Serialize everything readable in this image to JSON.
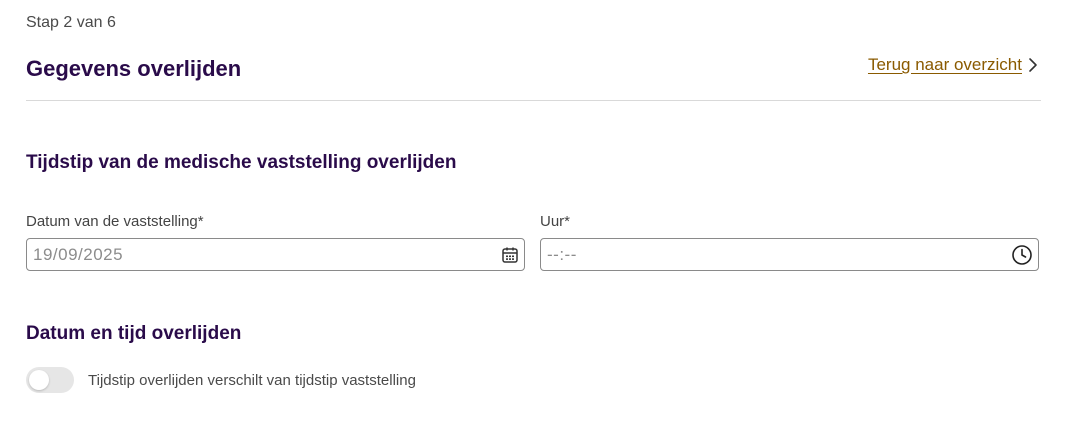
{
  "header": {
    "step": "Stap 2 van 6",
    "title": "Gegevens overlijden",
    "back_link": "Terug naar overzicht"
  },
  "sections": {
    "vaststelling": {
      "title": "Tijdstip van de medische vaststelling overlijden",
      "date_label": "Datum van de vaststelling*",
      "date_value": "19/09/2025",
      "time_label": "Uur*",
      "time_value": "--:--"
    },
    "overlijden": {
      "title": "Datum en tijd overlijden",
      "toggle_label": "Tijdstip overlijden verschilt van tijdstip vaststelling",
      "toggle_on": false
    }
  },
  "colors": {
    "title": "#2a0b4a",
    "link": "#8a5a00",
    "border": "#8a8a8a"
  },
  "icons": {
    "back": "chevron-right-icon",
    "date": "calendar-icon",
    "time": "clock-icon"
  }
}
